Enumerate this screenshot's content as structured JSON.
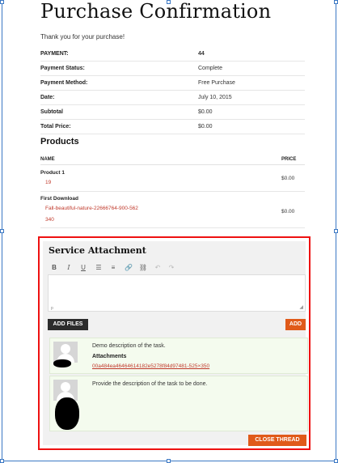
{
  "page": {
    "title": "Purchase Confirmation",
    "thank_you": "Thank you for your purchase!"
  },
  "summary": {
    "rows": [
      {
        "label": "PAYMENT:",
        "value": "44"
      },
      {
        "label": "Payment Status:",
        "value": "Complete"
      },
      {
        "label": "Payment Method:",
        "value": "Free Purchase"
      },
      {
        "label": "Date:",
        "value": "July 10, 2015"
      },
      {
        "label": "Subtotal",
        "value": "$0.00"
      },
      {
        "label": "Total Price:",
        "value": "$0.00"
      }
    ]
  },
  "products": {
    "heading": "Products",
    "col_name": "NAME",
    "col_price": "PRICE",
    "items": [
      {
        "name": "Product 1",
        "sub": [
          "19"
        ],
        "price": "$0.00"
      },
      {
        "name": "First Download",
        "sub": [
          "Fall-beautiful-nature-22666764-900-562",
          "340"
        ],
        "price": "$0.00"
      }
    ]
  },
  "service": {
    "title": "Service Attachment",
    "toolbar": [
      "bold-icon",
      "italic-icon",
      "underline-icon",
      "bullet-list-icon",
      "numbered-list-icon",
      "link-icon",
      "unlink-icon",
      "undo-icon",
      "redo-icon"
    ],
    "editor_path": "p",
    "add_files_label": "ADD FILES",
    "add_label": "ADD",
    "messages": [
      {
        "text": "Demo description of the task.",
        "attachments_label": "Attachments",
        "attachment": "00a484ea46464614182e5278f84d97481-525×350"
      },
      {
        "text": "Provide the description of the task to be done."
      }
    ],
    "close_label": "CLOSE THREAD"
  },
  "colors": {
    "accent": "#e05a1a",
    "link": "#c0392b",
    "highlight_border": "#ee1111",
    "message_bg": "#f4fbee"
  }
}
